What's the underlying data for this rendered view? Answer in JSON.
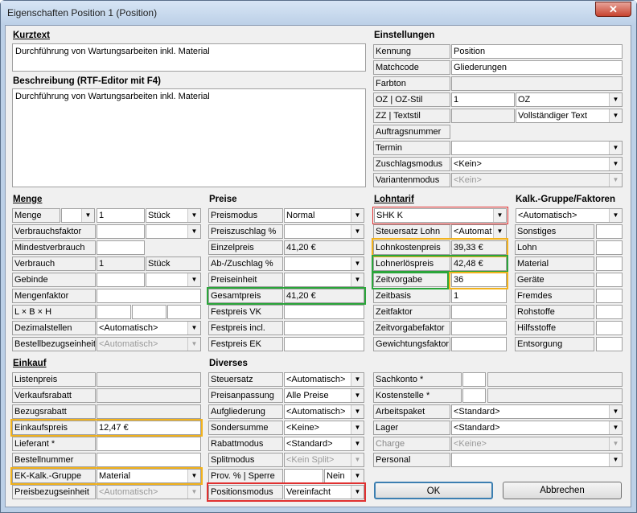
{
  "window": {
    "title": "Eigenschaften Position 1 (Position)",
    "close_glyph": "✕"
  },
  "kurztext": {
    "heading": "Kurztext",
    "value": "Durchführung von Wartungsarbeiten inkl. Material"
  },
  "beschreibung": {
    "heading": "Beschreibung (RTF-Editor mit F4)",
    "value": "Durchführung von Wartungsarbeiten inkl. Material"
  },
  "einstellungen": {
    "heading": "Einstellungen",
    "kennung": {
      "label": "Kennung",
      "value": "Position"
    },
    "matchcode": {
      "label": "Matchcode",
      "value": "Gliederungen"
    },
    "farbton": {
      "label": "Farbton"
    },
    "oz": {
      "label": "OZ | OZ-Stil",
      "value": "1",
      "stil": "OZ"
    },
    "zz": {
      "label": "ZZ | Textstil",
      "stil": "Vollständiger Text"
    },
    "auftragsnummer": {
      "label": "Auftragsnummer"
    },
    "termin": {
      "label": "Termin"
    },
    "zuschlagsmodus": {
      "label": "Zuschlagsmodus",
      "value": "<Kein>"
    },
    "variantenmodus": {
      "label": "Variantenmodus",
      "value": "<Kein>"
    }
  },
  "menge": {
    "heading": "Menge",
    "menge": {
      "label": "Menge",
      "value": "1",
      "unit": "Stück"
    },
    "verbrauchsfaktor": {
      "label": "Verbrauchsfaktor"
    },
    "mindestverbrauch": {
      "label": "Mindestverbrauch"
    },
    "verbrauch": {
      "label": "Verbrauch",
      "value": "1",
      "unit": "Stück"
    },
    "gebinde": {
      "label": "Gebinde"
    },
    "mengenfaktor": {
      "label": "Mengenfaktor"
    },
    "lbh": {
      "label": "L × B × H"
    },
    "dezimalstellen": {
      "label": "Dezimalstellen",
      "value": "<Automatisch>"
    },
    "bestellbezugseinheit": {
      "label": "Bestellbezugseinheit",
      "value": "<Automatisch>"
    }
  },
  "preise": {
    "heading": "Preise",
    "preismodus": {
      "label": "Preismodus",
      "value": "Normal"
    },
    "preiszuschlag": {
      "label": "Preiszuschlag %"
    },
    "einzelpreis": {
      "label": "Einzelpreis",
      "value": "41,20 €"
    },
    "abzuschlag": {
      "label": "Ab-/Zuschlag %"
    },
    "preiseinheit": {
      "label": "Preiseinheit"
    },
    "gesamtpreis": {
      "label": "Gesamtpreis",
      "value": "41,20 €"
    },
    "festpreisvk": {
      "label": "Festpreis VK"
    },
    "festpreisincl": {
      "label": "Festpreis incl."
    },
    "festpreisek": {
      "label": "Festpreis EK"
    }
  },
  "lohntarif": {
    "heading": "Lohntarif",
    "tarif": "SHK K",
    "steuersatzlohn": {
      "label": "Steuersatz Lohn",
      "value": "<Automat"
    },
    "lohnkostenpreis": {
      "label": "Lohnkostenpreis",
      "value": "39,33 €"
    },
    "lohnerloespreis": {
      "label": "Lohnerlöspreis",
      "value": "42,48 €"
    },
    "zeitvorgabe": {
      "label": "Zeitvorgabe",
      "value": "36"
    },
    "zeitbasis": {
      "label": "Zeitbasis",
      "value": "1"
    },
    "zeitfaktor": {
      "label": "Zeitfaktor"
    },
    "zeitvorgabefaktor": {
      "label": "Zeitvorgabefaktor"
    },
    "gewichtungsfaktor": {
      "label": "Gewichtungsfaktor"
    }
  },
  "kalk": {
    "heading": "Kalk.-Gruppe/Faktoren",
    "gruppe": "<Automatisch>",
    "rows": [
      "Sonstiges",
      "Lohn",
      "Material",
      "Geräte",
      "Fremdes",
      "Rohstoffe",
      "Hilfsstoffe",
      "Entsorgung"
    ]
  },
  "einkauf": {
    "heading": "Einkauf",
    "listenpreis": {
      "label": "Listenpreis"
    },
    "verkaufsrabatt": {
      "label": "Verkaufsrabatt"
    },
    "bezugsrabatt": {
      "label": "Bezugsrabatt"
    },
    "einkaufspreis": {
      "label": "Einkaufspreis",
      "value": "12,47 €"
    },
    "lieferant": {
      "label": "Lieferant *"
    },
    "bestellnummer": {
      "label": "Bestellnummer"
    },
    "ekkalk": {
      "label": "EK-Kalk.-Gruppe",
      "value": "Material"
    },
    "preisbezugseinheit": {
      "label": "Preisbezugseinheit",
      "value": "<Automatisch>"
    }
  },
  "diverses": {
    "heading": "Diverses",
    "steuersatz": {
      "label": "Steuersatz",
      "value": "<Automatisch>"
    },
    "preisanpassung": {
      "label": "Preisanpassung",
      "value": "Alle Preise"
    },
    "aufgliederung": {
      "label": "Aufgliederung",
      "value": "<Automatisch>"
    },
    "sondersumme": {
      "label": "Sondersumme",
      "value": "<Keine>"
    },
    "rabattmodus": {
      "label": "Rabattmodus",
      "value": "<Standard>"
    },
    "splitmodus": {
      "label": "Splitmodus",
      "value": "<Kein Split>"
    },
    "prov": {
      "label": "Prov. % | Sperre",
      "value": "Nein"
    },
    "positionsmodus": {
      "label": "Positionsmodus",
      "value": "Vereinfacht"
    }
  },
  "rechts": {
    "sachkonto": {
      "label": "Sachkonto *"
    },
    "kostenstelle": {
      "label": "Kostenstelle *"
    },
    "arbeitspaket": {
      "label": "Arbeitspaket",
      "value": "<Standard>"
    },
    "lager": {
      "label": "Lager",
      "value": "<Standard>"
    },
    "charge": {
      "label": "Charge",
      "value": "<Keine>"
    },
    "personal": {
      "label": "Personal"
    }
  },
  "buttons": {
    "ok": "OK",
    "cancel": "Abbrechen"
  },
  "colors": {
    "orange": "#f2b21c",
    "green": "#2aa53a",
    "red": "#e03030"
  }
}
